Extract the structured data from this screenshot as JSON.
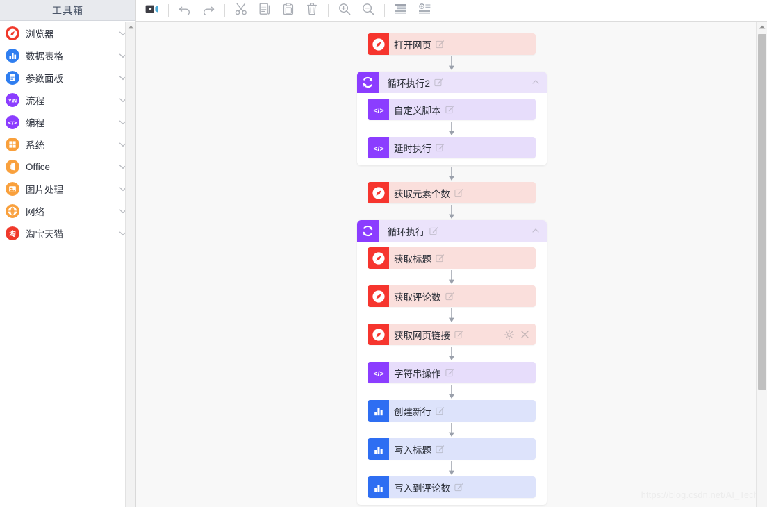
{
  "sidebar": {
    "title": "工具箱",
    "items": [
      {
        "label": "浏览器",
        "icon": "compass-icon",
        "color": "#f0392b",
        "glyph": "◎"
      },
      {
        "label": "数据表格",
        "icon": "bar-chart-icon",
        "color": "#2f7ef0",
        "glyph": "▮"
      },
      {
        "label": "参数面板",
        "icon": "document-icon",
        "color": "#2f7ef0",
        "glyph": "▤"
      },
      {
        "label": "流程",
        "icon": "yes-no-icon",
        "color": "#8b3dff",
        "glyph": "Y/N"
      },
      {
        "label": "编程",
        "icon": "code-icon",
        "color": "#8b3dff",
        "glyph": "</>"
      },
      {
        "label": "系统",
        "icon": "grid-icon",
        "color": "#f9a03c",
        "glyph": "⊞"
      },
      {
        "label": "Office",
        "icon": "office-icon",
        "color": "#f9a03c",
        "glyph": "❚"
      },
      {
        "label": "图片处理",
        "icon": "image-icon",
        "color": "#f9a03c",
        "glyph": "▭"
      },
      {
        "label": "网络",
        "icon": "globe-icon",
        "color": "#f9a03c",
        "glyph": "◍"
      },
      {
        "label": "淘宝天猫",
        "icon": "taobao-icon",
        "color": "#f0392b",
        "glyph": "淘"
      }
    ],
    "chevron_icon": "chevron-down-icon",
    "scroll_up_icon": "scroll-up-arrow-icon"
  },
  "toolbar": {
    "buttons": [
      {
        "name": "run-button",
        "icon": "play-video-icon"
      },
      {
        "name": "separator-1",
        "icon": "separator"
      },
      {
        "name": "undo-button",
        "icon": "undo-icon"
      },
      {
        "name": "redo-button",
        "icon": "redo-icon"
      },
      {
        "name": "separator-2",
        "icon": "separator"
      },
      {
        "name": "cut-button",
        "icon": "scissors-icon"
      },
      {
        "name": "copy-button",
        "icon": "copy-icon"
      },
      {
        "name": "paste-button",
        "icon": "paste-icon"
      },
      {
        "name": "delete-button",
        "icon": "trash-icon"
      },
      {
        "name": "separator-3",
        "icon": "separator"
      },
      {
        "name": "zoom-in-button",
        "icon": "zoom-in-icon"
      },
      {
        "name": "zoom-out-button",
        "icon": "zoom-out-icon"
      },
      {
        "name": "separator-4",
        "icon": "separator"
      },
      {
        "name": "collapse-all-button",
        "icon": "collapse-all-icon"
      },
      {
        "name": "expand-all-button",
        "icon": "expand-all-icon"
      }
    ]
  },
  "canvas": {
    "watermark": "https://blog.csdn.net/AI_Tech",
    "edit_icon": "edit-pencil-icon",
    "arrow_icon": "down-arrow-icon",
    "collapse_icon": "chevron-up-icon",
    "settings_icon": "gear-icon",
    "close_icon": "close-icon",
    "flow": [
      {
        "type": "node",
        "label": "打开网页",
        "theme": "browser",
        "icon": "compass-icon"
      },
      {
        "type": "loop",
        "label": "循环执行2",
        "icon": "loop-icon",
        "children": [
          {
            "type": "node",
            "label": "自定义脚本",
            "theme": "code",
            "icon": "code-icon"
          },
          {
            "type": "node",
            "label": "延时执行",
            "theme": "code",
            "icon": "code-icon"
          }
        ]
      },
      {
        "type": "node",
        "label": "获取元素个数",
        "theme": "browser",
        "icon": "compass-icon"
      },
      {
        "type": "loop",
        "label": "循环执行",
        "icon": "loop-icon",
        "children": [
          {
            "type": "node",
            "label": "获取标题",
            "theme": "browser",
            "icon": "compass-icon"
          },
          {
            "type": "node",
            "label": "获取评论数",
            "theme": "browser",
            "icon": "compass-icon"
          },
          {
            "type": "node",
            "label": "获取网页链接",
            "theme": "browser",
            "icon": "compass-icon",
            "hovered": true
          },
          {
            "type": "node",
            "label": "字符串操作",
            "theme": "code",
            "icon": "code-icon"
          },
          {
            "type": "node",
            "label": "创建新行",
            "theme": "table",
            "icon": "bar-chart-icon"
          },
          {
            "type": "node",
            "label": "写入标题",
            "theme": "table",
            "icon": "bar-chart-icon"
          },
          {
            "type": "node",
            "label": "写入到评论数",
            "theme": "table",
            "icon": "bar-chart-icon"
          }
        ]
      }
    ]
  }
}
